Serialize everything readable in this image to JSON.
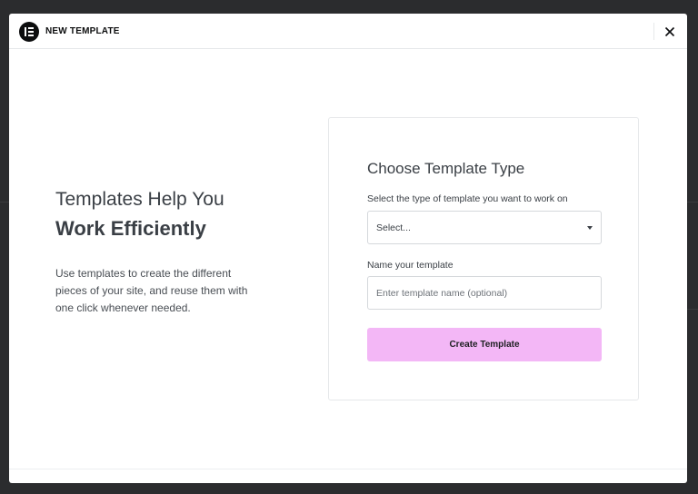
{
  "header": {
    "title": "NEW TEMPLATE",
    "logo_icon": "elementor-logo-icon",
    "close_icon": "close-icon"
  },
  "intro": {
    "title": "Templates Help You",
    "title_strong": "Work Efficiently",
    "description": "Use templates to create the different pieces of your site, and reuse them with one click whenever needed."
  },
  "form": {
    "title": "Choose Template Type",
    "type_label": "Select the type of template you want to work on",
    "type_select_value": "Select...",
    "name_label": "Name your template",
    "name_placeholder": "Enter template name (optional)",
    "name_value": "",
    "submit_label": "Create Template"
  },
  "colors": {
    "accent_button": "#f3b7f6",
    "backdrop": "#2b2c2e",
    "text": "#3a3f45"
  }
}
